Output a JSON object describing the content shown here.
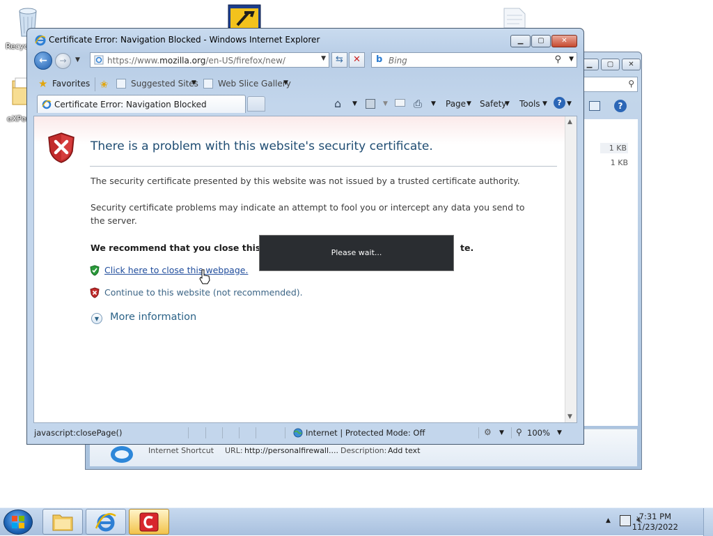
{
  "desktop": {
    "recycle_label": "Recyc",
    "folder_label": "eXPer"
  },
  "explorer": {
    "sizes": [
      "1 KB",
      "1 KB"
    ],
    "details": {
      "type": "Internet Shortcut",
      "url_label": "URL:",
      "url_value": "http://personalfirewall....",
      "desc_label": "Description:",
      "desc_value": "Add text"
    }
  },
  "ie": {
    "title": "Certificate Error: Navigation Blocked - Windows Internet Explorer",
    "address": {
      "prefix": "https://www.",
      "domain": "mozilla.org",
      "path": "/en-US/firefox/new/"
    },
    "search_placeholder": "Bing",
    "favorites": {
      "favorites_label": "Favorites",
      "suggested_sites": "Suggested Sites",
      "web_slice_gallery": "Web Slice Gallery"
    },
    "tab_label": "Certificate Error: Navigation Blocked",
    "command_bar": {
      "page": "Page",
      "safety": "Safety",
      "tools": "Tools"
    },
    "content": {
      "heading": "There is a problem with this website's security certificate.",
      "para1": "The security certificate presented by this website was not issued by a trusted certificate authority.",
      "para2": "Security certificate problems may indicate an attempt to fool you or intercept any data you send to the server.",
      "recommend_start": "We recommend that you close this w",
      "recommend_end": "te.",
      "close_link": "Click here to close this webpage.",
      "continue_link": "Continue to this website (not recommended).",
      "more_info": "More information"
    },
    "wait_dialog": "Please wait...",
    "status": {
      "left": "javascript:closePage()",
      "zone": "Internet | Protected Mode: Off",
      "zoom": "100%"
    }
  },
  "taskbar": {
    "time": "7:31 PM",
    "date": "11/23/2022"
  }
}
